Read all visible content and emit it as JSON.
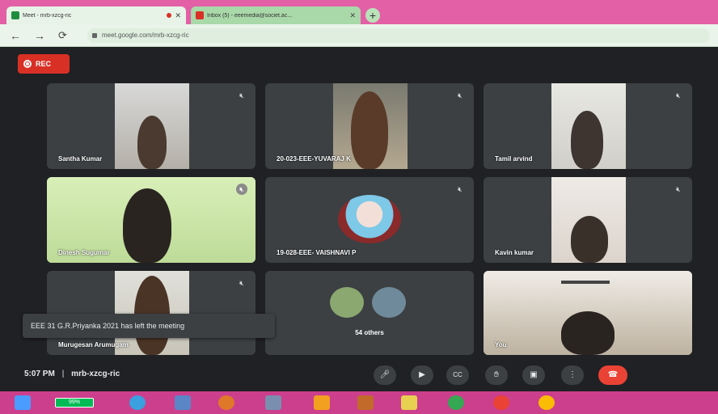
{
  "browser": {
    "tabs": [
      {
        "title": "Meet - mrb-xzcg-ric",
        "active": true
      },
      {
        "title": "Inbox (5) - eeemedia@societ.ac...",
        "active": false
      }
    ],
    "url": "meet.google.com/mrb-xzcg-ric"
  },
  "meet": {
    "rec_label": "REC",
    "tiles": [
      {
        "name": "Santha Kumar"
      },
      {
        "name": "20-023-EEE-YUVARAJ K"
      },
      {
        "name": "Tamil arvind"
      },
      {
        "name": "Dinesh Sugumar"
      },
      {
        "name": "19-028-EEE- VAISHNAVI P"
      },
      {
        "name": "Kavin kumar"
      },
      {
        "name": "Murugesan Arumugam"
      },
      {
        "name": "54 others"
      },
      {
        "name": "You"
      }
    ],
    "toast": "EEE 31 G.R.Priyanka 2021 has left the meeting",
    "time": "5:07 PM",
    "separator": "|",
    "meeting_code": "mrb-xzcg-ric"
  },
  "taskbar": {
    "battery": "99%"
  },
  "colors": {
    "meet_bg": "#202124",
    "tile_bg": "#3c4043",
    "rec_red": "#d93025",
    "hangup_red": "#ea4335",
    "taskbar": "#cc3f8c"
  }
}
